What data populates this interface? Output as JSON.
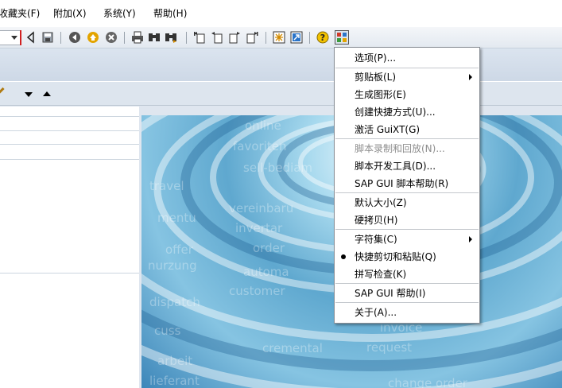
{
  "menubar": {
    "items": [
      "收藏夹(F)",
      "附加(X)",
      "系统(Y)",
      "帮助(H)"
    ]
  },
  "toolbar": {
    "icons": [
      "enter-icon",
      "save-icon",
      "back-icon",
      "exit-icon",
      "cancel-icon",
      "print-icon",
      "find-icon",
      "find-next-icon",
      "first-page-icon",
      "previous-page-icon",
      "next-page-icon",
      "last-page-icon",
      "create-session-icon",
      "shortcut-icon",
      "help-icon",
      "customize-layout-icon"
    ]
  },
  "context_menu": {
    "items": [
      {
        "label": "选项(P)...",
        "disabled": false,
        "submenu": false,
        "checked": false
      },
      {
        "label": "剪贴板(L)",
        "disabled": false,
        "submenu": true,
        "checked": false
      },
      {
        "label": "生成图形(E)",
        "disabled": false,
        "submenu": false,
        "checked": false
      },
      {
        "label": "创建快捷方式(U)...",
        "disabled": false,
        "submenu": false,
        "checked": false
      },
      {
        "label": "激活 GuiXT(G)",
        "disabled": false,
        "submenu": false,
        "checked": false
      },
      {
        "label": "脚本录制和回放(N)...",
        "disabled": true,
        "submenu": false,
        "checked": false
      },
      {
        "label": "脚本开发工具(D)...",
        "disabled": false,
        "submenu": false,
        "checked": false
      },
      {
        "label": "SAP GUI 脚本帮助(R)",
        "disabled": false,
        "submenu": false,
        "checked": false
      },
      {
        "label": "默认大小(Z)",
        "disabled": false,
        "submenu": false,
        "checked": false
      },
      {
        "label": "硬拷贝(H)",
        "disabled": false,
        "submenu": false,
        "checked": false
      },
      {
        "label": "字符集(C)",
        "disabled": false,
        "submenu": true,
        "checked": false
      },
      {
        "label": "快捷剪切和粘贴(Q)",
        "disabled": false,
        "submenu": false,
        "checked": true
      },
      {
        "label": "拼写检查(K)",
        "disabled": false,
        "submenu": false,
        "checked": false
      },
      {
        "label": "SAP GUI 帮助(I)",
        "disabled": false,
        "submenu": false,
        "checked": false
      },
      {
        "label": "关于(A)...",
        "disabled": false,
        "submenu": false,
        "checked": false
      }
    ]
  },
  "background_image": {
    "watermark_words": [
      "online",
      "favoriten",
      "sell-bediam",
      "travel",
      "vereinbaru",
      "mentu",
      "offer",
      "invertar",
      "nurzung",
      "order",
      "automa",
      "dispatch",
      "cuss",
      "customer",
      "arbeit",
      "lieferant",
      "request",
      "change order",
      "invoice",
      "cremental"
    ]
  }
}
